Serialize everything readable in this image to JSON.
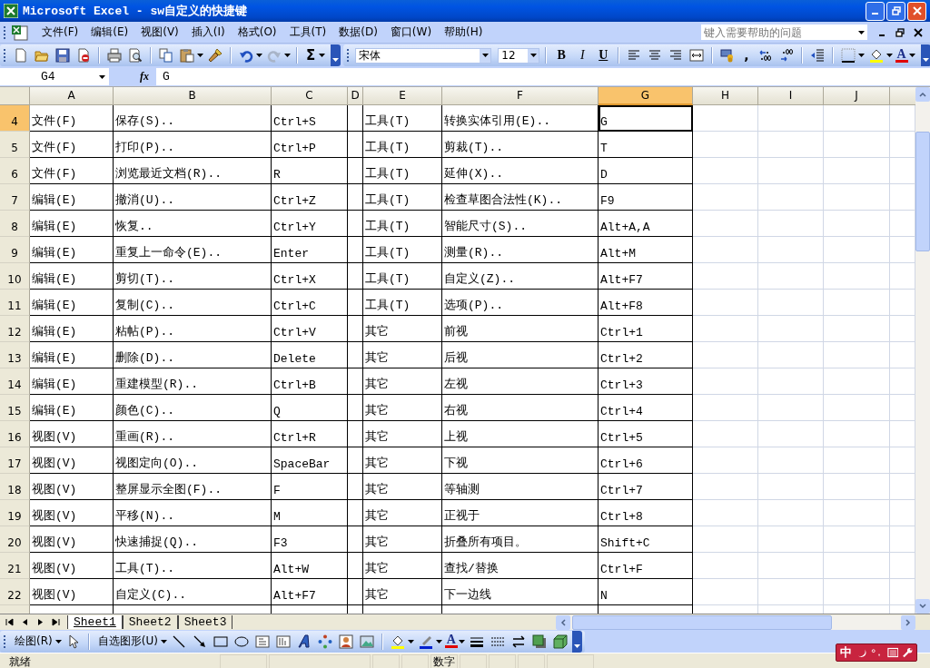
{
  "window": {
    "title": "Microsoft Excel - sw自定义的快捷键"
  },
  "menu": [
    {
      "label": "文件(F)"
    },
    {
      "label": "编辑(E)"
    },
    {
      "label": "视图(V)"
    },
    {
      "label": "插入(I)"
    },
    {
      "label": "格式(O)"
    },
    {
      "label": "工具(T)"
    },
    {
      "label": "数据(D)"
    },
    {
      "label": "窗口(W)"
    },
    {
      "label": "帮助(H)"
    }
  ],
  "help_search": {
    "placeholder": "键入需要帮助的问题"
  },
  "standard_toolbar": {
    "sum_label": "Σ",
    "redo_disabled": true
  },
  "formatting_toolbar": {
    "font": "宋体",
    "size": "12",
    "style_buttons": [
      {
        "label": "B",
        "kind": "bold"
      },
      {
        "label": "I",
        "kind": "italic"
      },
      {
        "label": "U",
        "kind": "underline"
      }
    ],
    "comma_label": ",",
    "font_color_label": "A"
  },
  "formula_bar": {
    "name_box": "G4",
    "fx_label": "fx",
    "value": "G"
  },
  "columns": [
    {
      "label": "A",
      "selected": false
    },
    {
      "label": "B",
      "selected": false
    },
    {
      "label": "C",
      "selected": false
    },
    {
      "label": "D",
      "selected": false
    },
    {
      "label": "E",
      "selected": false
    },
    {
      "label": "F",
      "selected": false
    },
    {
      "label": "G",
      "selected": true
    },
    {
      "label": "H",
      "selected": false
    },
    {
      "label": "I",
      "selected": false
    },
    {
      "label": "J",
      "selected": false
    }
  ],
  "rows": [
    {
      "number": "4",
      "selected": true,
      "cells": {
        "a": "文件(F)",
        "b": "保存(S)..",
        "c": "Ctrl+S",
        "e": "工具(T)",
        "f": "转换实体引用(E)..",
        "g": "G"
      }
    },
    {
      "number": "5",
      "selected": false,
      "cells": {
        "a": "文件(F)",
        "b": "打印(P)..",
        "c": "Ctrl+P",
        "e": "工具(T)",
        "f": "剪裁(T)..",
        "g": "T"
      }
    },
    {
      "number": "6",
      "selected": false,
      "cells": {
        "a": "文件(F)",
        "b": "浏览最近文档(R)..",
        "c": "R",
        "e": "工具(T)",
        "f": "延伸(X)..",
        "g": "D"
      }
    },
    {
      "number": "7",
      "selected": false,
      "cells": {
        "a": "编辑(E)",
        "b": "撤消(U)..",
        "c": "Ctrl+Z",
        "e": "工具(T)",
        "f": "检查草图合法性(K)..",
        "g": "F9"
      }
    },
    {
      "number": "8",
      "selected": false,
      "cells": {
        "a": "编辑(E)",
        "b": "恢复..",
        "c": "Ctrl+Y",
        "e": "工具(T)",
        "f": "智能尺寸(S)..",
        "g": "Alt+A,A"
      }
    },
    {
      "number": "9",
      "selected": false,
      "cells": {
        "a": "编辑(E)",
        "b": "重复上一命令(E)..",
        "c": "Enter",
        "e": "工具(T)",
        "f": "测量(R)..",
        "g": "Alt+M"
      }
    },
    {
      "number": "10",
      "selected": false,
      "cells": {
        "a": "编辑(E)",
        "b": "剪切(T)..",
        "c": "Ctrl+X",
        "e": "工具(T)",
        "f": "自定义(Z)..",
        "g": "Alt+F7"
      }
    },
    {
      "number": "11",
      "selected": false,
      "cells": {
        "a": "编辑(E)",
        "b": "复制(C)..",
        "c": "Ctrl+C",
        "e": "工具(T)",
        "f": "选项(P)..",
        "g": "Alt+F8"
      }
    },
    {
      "number": "12",
      "selected": false,
      "cells": {
        "a": "编辑(E)",
        "b": "粘帖(P)..",
        "c": "Ctrl+V",
        "e": "其它",
        "f": "前视",
        "g": "Ctrl+1"
      }
    },
    {
      "number": "13",
      "selected": false,
      "cells": {
        "a": "编辑(E)",
        "b": "删除(D)..",
        "c": "Delete",
        "e": "其它",
        "f": "后视",
        "g": "Ctrl+2"
      }
    },
    {
      "number": "14",
      "selected": false,
      "cells": {
        "a": "编辑(E)",
        "b": "重建模型(R)..",
        "c": "Ctrl+B",
        "e": "其它",
        "f": "左视",
        "g": "Ctrl+3"
      }
    },
    {
      "number": "15",
      "selected": false,
      "cells": {
        "a": "编辑(E)",
        "b": "颜色(C)..",
        "c": "Q",
        "e": "其它",
        "f": "右视",
        "g": "Ctrl+4"
      }
    },
    {
      "number": "16",
      "selected": false,
      "cells": {
        "a": "视图(V)",
        "b": "重画(R)..",
        "c": "Ctrl+R",
        "e": "其它",
        "f": "上视",
        "g": "Ctrl+5"
      }
    },
    {
      "number": "17",
      "selected": false,
      "cells": {
        "a": "视图(V)",
        "b": "视图定向(O)..",
        "c": "SpaceBar",
        "e": "其它",
        "f": "下视",
        "g": "Ctrl+6"
      }
    },
    {
      "number": "18",
      "selected": false,
      "cells": {
        "a": "视图(V)",
        "b": "整屏显示全图(F)..",
        "c": "F",
        "e": "其它",
        "f": "等轴测",
        "g": "Ctrl+7"
      }
    },
    {
      "number": "19",
      "selected": false,
      "cells": {
        "a": "视图(V)",
        "b": "平移(N)..",
        "c": "M",
        "e": "其它",
        "f": "正视于",
        "g": "Ctrl+8"
      }
    },
    {
      "number": "20",
      "selected": false,
      "cells": {
        "a": "视图(V)",
        "b": "快速捕捉(Q)..",
        "c": "F3",
        "e": "其它",
        "f": "折叠所有项目。",
        "g": "Shift+C"
      }
    },
    {
      "number": "21",
      "selected": false,
      "cells": {
        "a": "视图(V)",
        "b": "工具(T)..",
        "c": "Alt+W",
        "e": "其它",
        "f": "查找/替换",
        "g": "Ctrl+F"
      }
    },
    {
      "number": "22",
      "selected": false,
      "cells": {
        "a": "视图(V)",
        "b": "自定义(C)..",
        "c": "Alt+F7",
        "e": "其它",
        "f": "下一边线",
        "g": "N"
      }
    }
  ],
  "sheet_tabs": [
    {
      "label": "Sheet1",
      "selected": true
    },
    {
      "label": "Sheet2",
      "selected": false
    },
    {
      "label": "Sheet3",
      "selected": false
    }
  ],
  "drawing_toolbar": {
    "draw_menu": "绘图(R)",
    "autoshapes_menu": "自选图形(U)",
    "font_color_label": "A"
  },
  "ime_bar": {
    "mode": "中"
  },
  "status_bar": {
    "status": "就绪",
    "mode": "数字"
  }
}
